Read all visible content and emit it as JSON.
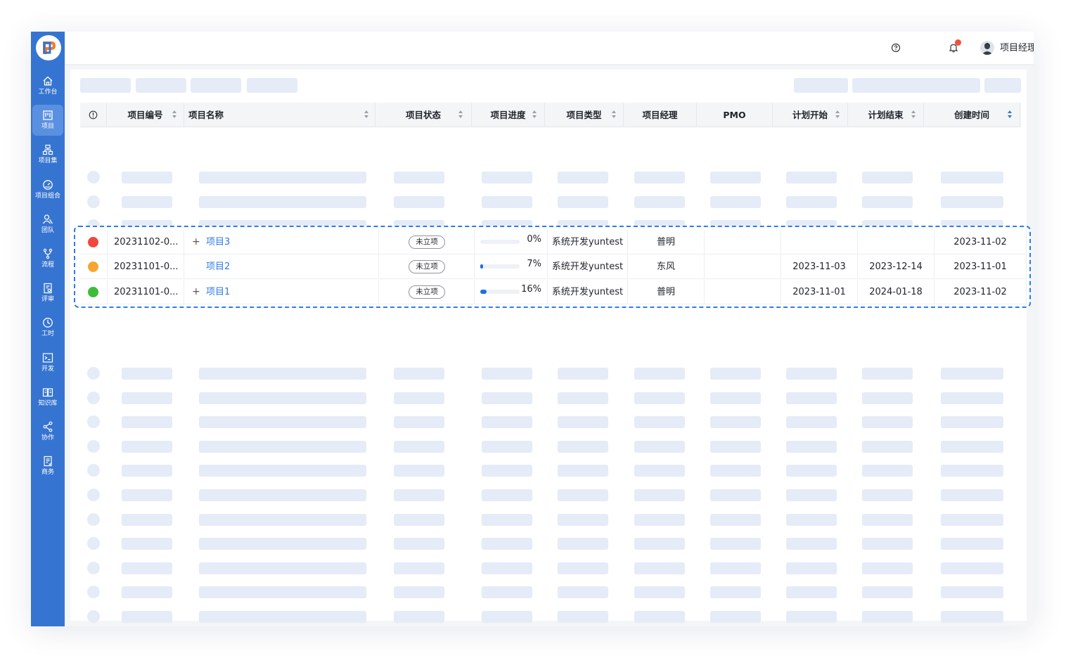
{
  "sidebar": {
    "items": [
      {
        "label": "工作台",
        "icon": "home-icon"
      },
      {
        "label": "项目",
        "icon": "project-board-icon",
        "active": true
      },
      {
        "label": "项目集",
        "icon": "program-hierarchy-icon"
      },
      {
        "label": "项目组合",
        "icon": "portfolio-gauge-icon"
      },
      {
        "label": "团队",
        "icon": "team-icon"
      },
      {
        "label": "流程",
        "icon": "workflow-icon"
      },
      {
        "label": "评审",
        "icon": "review-document-icon"
      },
      {
        "label": "工时",
        "icon": "clock-icon"
      },
      {
        "label": "开发",
        "icon": "terminal-icon"
      },
      {
        "label": "知识库",
        "icon": "book-icon"
      },
      {
        "label": "协作",
        "icon": "share-icon"
      },
      {
        "label": "商务",
        "icon": "business-document-icon"
      }
    ]
  },
  "header": {
    "help_icon": "help-circle-icon",
    "bell_icon": "bell-icon",
    "notification_badge": "",
    "user_name": "项目经理 PM"
  },
  "table": {
    "columns": [
      "项目编号",
      "项目名称",
      "项目状态",
      "项目进度",
      "项目类型",
      "项目经理",
      "PMO",
      "计划开始",
      "计划结束",
      "创建时间"
    ],
    "rows": [
      {
        "status_color": "#f0483e",
        "id": "20231102-0...",
        "expandable": true,
        "name": "项目3",
        "state": "未立项",
        "progress": 0,
        "progress_label": "0%",
        "type": "系统开发yuntest",
        "manager": "普明",
        "pmo": "",
        "plan_start": "",
        "plan_end": "",
        "created": "2023-11-02"
      },
      {
        "status_color": "#f5a532",
        "id": "20231101-0...",
        "expandable": false,
        "name": "项目2",
        "state": "未立项",
        "progress": 7,
        "progress_label": "7%",
        "type": "系统开发yuntest",
        "manager": "东风",
        "pmo": "",
        "plan_start": "2023-11-03",
        "plan_end": "2023-12-14",
        "created": "2023-11-01"
      },
      {
        "status_color": "#3fbd3a",
        "id": "20231101-0...",
        "expandable": true,
        "name": "项目1",
        "state": "未立项",
        "progress": 16,
        "progress_label": "16%",
        "type": "系统开发yuntest",
        "manager": "普明",
        "pmo": "",
        "plan_start": "2023-11-01",
        "plan_end": "2024-01-18",
        "created": "2023-11-02"
      }
    ]
  },
  "colors": {
    "sidebar": "#3674d1",
    "accent": "#2f7be8",
    "skeleton": "#e5ebf7"
  }
}
